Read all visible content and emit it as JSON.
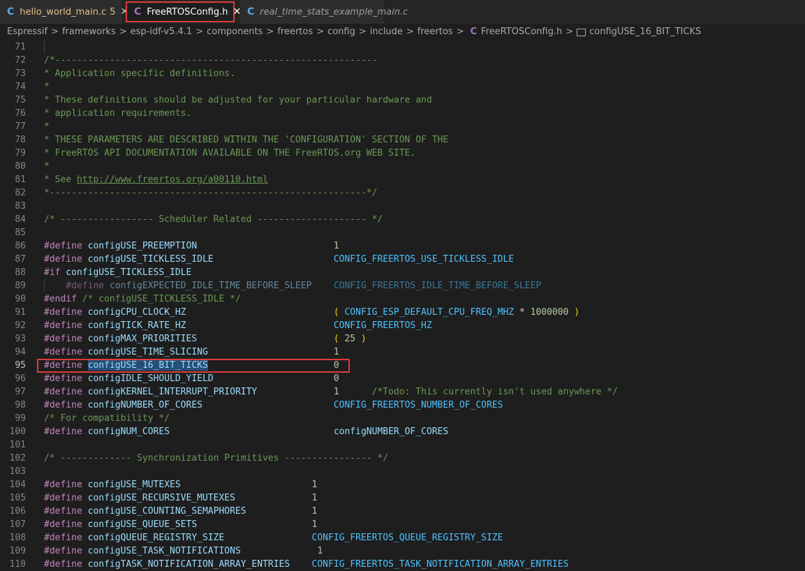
{
  "tabs": [
    {
      "icon": "C",
      "label": "hello_world_main.c",
      "badge": "5",
      "close": "✕"
    },
    {
      "icon": "C",
      "label": "FreeRTOSConfig.h",
      "close": "✕"
    },
    {
      "icon": "C",
      "label": "real_time_stats_example_main.c"
    }
  ],
  "breadcrumb": {
    "parts": [
      "Espressif",
      "frameworks",
      "esp-idf-v5.4.1",
      "components",
      "freertos",
      "config",
      "include",
      "freertos"
    ],
    "file_icon": "C",
    "file": "FreeRTOSConfig.h",
    "symbol": "configUSE_16_BIT_TICKS",
    "separator": ">"
  },
  "editor": {
    "lines": [
      {
        "n": "71",
        "t": []
      },
      {
        "n": "72",
        "t": [
          {
            "s": "/*-----------------------------------------------------------",
            "c": "cm"
          }
        ]
      },
      {
        "n": "73",
        "t": [
          {
            "s": "* Application specific definitions.",
            "c": "cm"
          }
        ]
      },
      {
        "n": "74",
        "t": [
          {
            "s": "*",
            "c": "cm"
          }
        ]
      },
      {
        "n": "75",
        "t": [
          {
            "s": "* These definitions should be adjusted for your particular hardware and",
            "c": "cm"
          }
        ]
      },
      {
        "n": "76",
        "t": [
          {
            "s": "* application requirements.",
            "c": "cm"
          }
        ]
      },
      {
        "n": "77",
        "t": [
          {
            "s": "*",
            "c": "cm"
          }
        ]
      },
      {
        "n": "78",
        "t": [
          {
            "s": "* THESE PARAMETERS ARE DESCRIBED WITHIN THE 'CONFIGURATION' SECTION OF THE",
            "c": "cm"
          }
        ]
      },
      {
        "n": "79",
        "t": [
          {
            "s": "* FreeRTOS API DOCUMENTATION AVAILABLE ON THE FreeRTOS.org WEB SITE.",
            "c": "cm"
          }
        ]
      },
      {
        "n": "80",
        "t": [
          {
            "s": "*",
            "c": "cm"
          }
        ]
      },
      {
        "n": "81",
        "t": [
          {
            "s": "* See ",
            "c": "cm"
          },
          {
            "s": "http://www.freertos.org/a00110.html",
            "c": "cm link"
          }
        ]
      },
      {
        "n": "82",
        "t": [
          {
            "s": "*----------------------------------------------------------*/",
            "c": "cm"
          }
        ]
      },
      {
        "n": "83",
        "t": []
      },
      {
        "n": "84",
        "t": [
          {
            "s": "/* ----------------- Scheduler Related -------------------- */",
            "c": "cm"
          }
        ]
      },
      {
        "n": "85",
        "t": []
      },
      {
        "n": "86",
        "t": [
          {
            "s": "#define",
            "c": "pp"
          },
          {
            "s": " configUSE_PREEMPTION                         ",
            "c": "mac"
          },
          {
            "s": "1",
            "c": "num"
          }
        ]
      },
      {
        "n": "87",
        "t": [
          {
            "s": "#define",
            "c": "pp"
          },
          {
            "s": " configUSE_TICKLESS_IDLE                      ",
            "c": "mac"
          },
          {
            "s": "CONFIG_FREERTOS_USE_TICKLESS_IDLE",
            "c": "id"
          }
        ]
      },
      {
        "n": "88",
        "t": [
          {
            "s": "#if",
            "c": "pp"
          },
          {
            "s": " configUSE_TICKLESS_IDLE",
            "c": "mac"
          }
        ]
      },
      {
        "n": "89",
        "dim": true,
        "t": [
          {
            "s": "    #define",
            "c": "pp"
          },
          {
            "s": " configEXPECTED_IDLE_TIME_BEFORE_SLEEP    ",
            "c": "mac"
          },
          {
            "s": "CONFIG_FREERTOS_IDLE_TIME_BEFORE_SLEEP",
            "c": "id"
          }
        ]
      },
      {
        "n": "90",
        "t": [
          {
            "s": "#endif",
            "c": "pp"
          },
          {
            "s": " /* configUSE_TICKLESS_IDLE */",
            "c": "cm"
          }
        ]
      },
      {
        "n": "91",
        "t": [
          {
            "s": "#define",
            "c": "pp"
          },
          {
            "s": " configCPU_CLOCK_HZ                           ",
            "c": "mac"
          },
          {
            "s": "(",
            "c": "bk"
          },
          {
            "s": " CONFIG_ESP_DEFAULT_CPU_FREQ_MHZ ",
            "c": "id"
          },
          {
            "s": "* ",
            "c": "op"
          },
          {
            "s": "1000000",
            "c": "num"
          },
          {
            "s": " )",
            "c": "bk"
          }
        ]
      },
      {
        "n": "92",
        "t": [
          {
            "s": "#define",
            "c": "pp"
          },
          {
            "s": " configTICK_RATE_HZ                           ",
            "c": "mac"
          },
          {
            "s": "CONFIG_FREERTOS_HZ",
            "c": "id"
          }
        ]
      },
      {
        "n": "93",
        "t": [
          {
            "s": "#define",
            "c": "pp"
          },
          {
            "s": " configMAX_PRIORITIES                         ",
            "c": "mac"
          },
          {
            "s": "(",
            "c": "bk"
          },
          {
            "s": " 25 ",
            "c": "num"
          },
          {
            "s": ")",
            "c": "bk"
          }
        ]
      },
      {
        "n": "94",
        "t": [
          {
            "s": "#define",
            "c": "pp"
          },
          {
            "s": " configUSE_TIME_SLICING                       ",
            "c": "mac"
          },
          {
            "s": "1",
            "c": "num"
          }
        ]
      },
      {
        "n": "95",
        "active": true,
        "t": [
          {
            "s": "#define",
            "c": "pp"
          },
          {
            "s": " ",
            "c": "mac"
          },
          {
            "s": "configUSE_16_BIT_TICKS",
            "c": "mac sel"
          },
          {
            "s": "                       ",
            "c": "mac"
          },
          {
            "s": "0",
            "c": "num"
          }
        ]
      },
      {
        "n": "96",
        "t": [
          {
            "s": "#define",
            "c": "pp"
          },
          {
            "s": " configIDLE_SHOULD_YIELD                      ",
            "c": "mac"
          },
          {
            "s": "0",
            "c": "num"
          }
        ]
      },
      {
        "n": "97",
        "t": [
          {
            "s": "#define",
            "c": "pp"
          },
          {
            "s": " configKERNEL_INTERRUPT_PRIORITY              ",
            "c": "mac"
          },
          {
            "s": "1      ",
            "c": "num"
          },
          {
            "s": "/*Todo: This currently isn't used anywhere */",
            "c": "cm"
          }
        ]
      },
      {
        "n": "98",
        "t": [
          {
            "s": "#define",
            "c": "pp"
          },
          {
            "s": " configNUMBER_OF_CORES                        ",
            "c": "mac"
          },
          {
            "s": "CONFIG_FREERTOS_NUMBER_OF_CORES",
            "c": "id"
          }
        ]
      },
      {
        "n": "99",
        "t": [
          {
            "s": "/* For compatibility */",
            "c": "cm"
          }
        ]
      },
      {
        "n": "100",
        "t": [
          {
            "s": "#define",
            "c": "pp"
          },
          {
            "s": " configNUM_CORES                              ",
            "c": "mac"
          },
          {
            "s": "configNUMBER_OF_CORES",
            "c": "mac"
          }
        ]
      },
      {
        "n": "101",
        "t": []
      },
      {
        "n": "102",
        "t": [
          {
            "s": "/* ------------- Synchronization Primitives ---------------- */",
            "c": "cm"
          }
        ]
      },
      {
        "n": "103",
        "t": []
      },
      {
        "n": "104",
        "t": [
          {
            "s": "#define",
            "c": "pp"
          },
          {
            "s": " configUSE_MUTEXES                        ",
            "c": "mac"
          },
          {
            "s": "1",
            "c": "num"
          }
        ]
      },
      {
        "n": "105",
        "t": [
          {
            "s": "#define",
            "c": "pp"
          },
          {
            "s": " configUSE_RECURSIVE_MUTEXES              ",
            "c": "mac"
          },
          {
            "s": "1",
            "c": "num"
          }
        ]
      },
      {
        "n": "106",
        "t": [
          {
            "s": "#define",
            "c": "pp"
          },
          {
            "s": " configUSE_COUNTING_SEMAPHORES            ",
            "c": "mac"
          },
          {
            "s": "1",
            "c": "num"
          }
        ]
      },
      {
        "n": "107",
        "t": [
          {
            "s": "#define",
            "c": "pp"
          },
          {
            "s": " configUSE_QUEUE_SETS                     ",
            "c": "mac"
          },
          {
            "s": "1",
            "c": "num"
          }
        ]
      },
      {
        "n": "108",
        "t": [
          {
            "s": "#define",
            "c": "pp"
          },
          {
            "s": " configQUEUE_REGISTRY_SIZE                ",
            "c": "mac"
          },
          {
            "s": "CONFIG_FREERTOS_QUEUE_REGISTRY_SIZE",
            "c": "id"
          }
        ]
      },
      {
        "n": "109",
        "t": [
          {
            "s": "#define",
            "c": "pp"
          },
          {
            "s": " configUSE_TASK_NOTIFICATIONS              ",
            "c": "mac"
          },
          {
            "s": "1",
            "c": "num"
          }
        ]
      },
      {
        "n": "110",
        "t": [
          {
            "s": "#define",
            "c": "pp"
          },
          {
            "s": " configTASK_NOTIFICATION_ARRAY_ENTRIES    ",
            "c": "mac"
          },
          {
            "s": "CONFIG_FREERTOS_TASK_NOTIFICATION_ARRAY_ENTRIES",
            "c": "id"
          }
        ]
      }
    ]
  }
}
